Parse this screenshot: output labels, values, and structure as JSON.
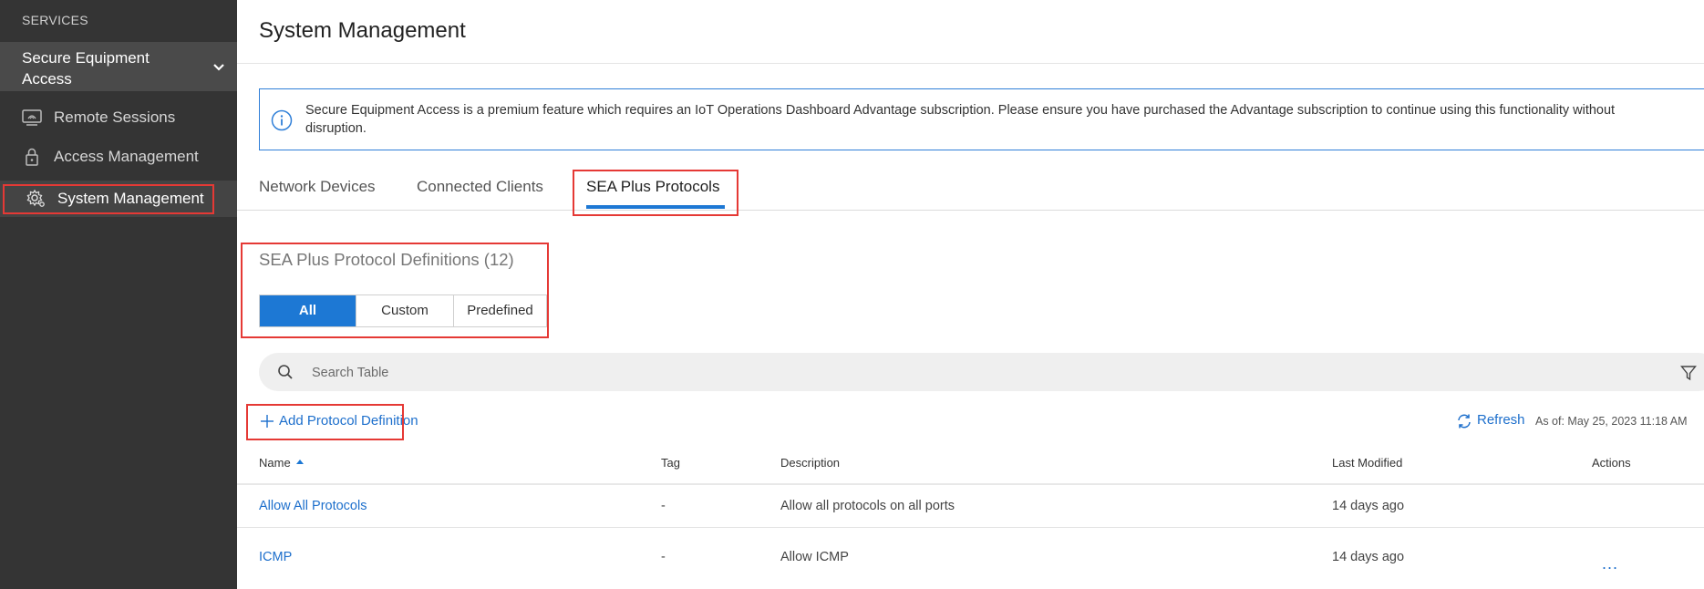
{
  "sidebar": {
    "section_label": "SERVICES",
    "service_title": "Secure Equipment Access",
    "items": [
      {
        "label": "Remote Sessions",
        "icon": "remote-sessions-icon"
      },
      {
        "label": "Access Management",
        "icon": "lock-icon"
      },
      {
        "label": "System Management",
        "icon": "gear-icon",
        "active": true
      }
    ]
  },
  "main": {
    "title": "System Management",
    "banner": "Secure Equipment Access is a premium feature which requires an IoT Operations Dashboard Advantage subscription. Please ensure you have purchased the Advantage subscription to continue using this functionality without disruption.",
    "tabs": [
      {
        "label": "Network Devices"
      },
      {
        "label": "Connected Clients"
      },
      {
        "label": "SEA Plus Protocols",
        "active": true
      }
    ],
    "definitions_title": "SEA Plus Protocol Definitions (12)",
    "filter_buttons": [
      "All",
      "Custom",
      "Predefined"
    ],
    "filter_selected": "All",
    "search_placeholder": "Search Table",
    "add_label": "Add Protocol Definition",
    "refresh_label": "Refresh",
    "as_of": "As of: May 25, 2023 11:18 AM",
    "table": {
      "headers": [
        "Name",
        "Tag",
        "Description",
        "Last Modified",
        "Actions"
      ],
      "sort_column": "Name",
      "sort_direction": "ascending",
      "rows": [
        {
          "name": "Allow All Protocols",
          "tag": "-",
          "description": "Allow all protocols on all ports",
          "modified": "14 days ago"
        },
        {
          "name": "ICMP",
          "tag": "-",
          "description": "Allow ICMP",
          "modified": "14 days ago",
          "actions": "..."
        }
      ]
    }
  },
  "colors": {
    "sidebar_bg": "#343434",
    "accent": "#1d78d4",
    "link": "#1d6fcc",
    "highlight": "#e53935"
  }
}
